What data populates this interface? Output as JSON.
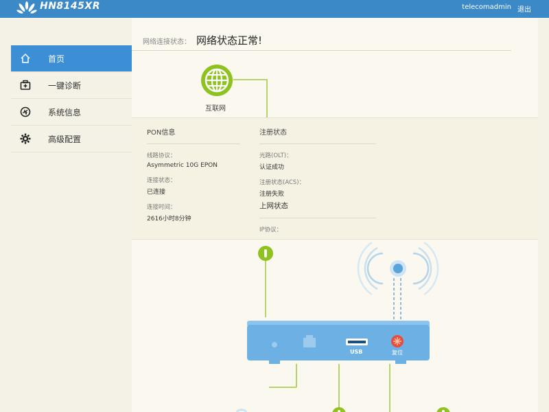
{
  "header": {
    "model": "HN8145XR",
    "user": "telecomadmin",
    "logout": "退出",
    "bar_color": "#3c89c8",
    "logo_icon": "huawei-logo"
  },
  "sidebar": {
    "items": [
      {
        "label": "首页",
        "icon": "home-icon",
        "active": true
      },
      {
        "label": "一键诊断",
        "icon": "toolbox-icon",
        "active": false
      },
      {
        "label": "系统信息",
        "icon": "gauge-icon",
        "active": false
      },
      {
        "label": "高级配置",
        "icon": "gear-icon",
        "active": false
      }
    ],
    "active_color": "#3c8fd4"
  },
  "main": {
    "status_label": "网络连接状态：",
    "status_value": "网络状态正常!",
    "internet_label": "互联网",
    "pon": {
      "title": "PON信息",
      "fields": [
        {
          "label": "线路协议：",
          "value": "Asymmetric 10G EPON"
        },
        {
          "label": "连接状态：",
          "value": "已连接"
        },
        {
          "label": "连接时间：",
          "value": "2616小时8分钟"
        }
      ]
    },
    "reg": {
      "title": "注册状态",
      "fields": [
        {
          "label": "光路(OLT)：",
          "value": "认证成功"
        },
        {
          "label": "注册状态(ACS)：",
          "value": "注册失败"
        }
      ],
      "online_status": "上网状态",
      "ip_label": "IP协议："
    },
    "device": {
      "usb_label": "USB",
      "reset_label": "复位"
    },
    "accent_green": "#8dc21f",
    "line_color": "#b5d36a"
  }
}
